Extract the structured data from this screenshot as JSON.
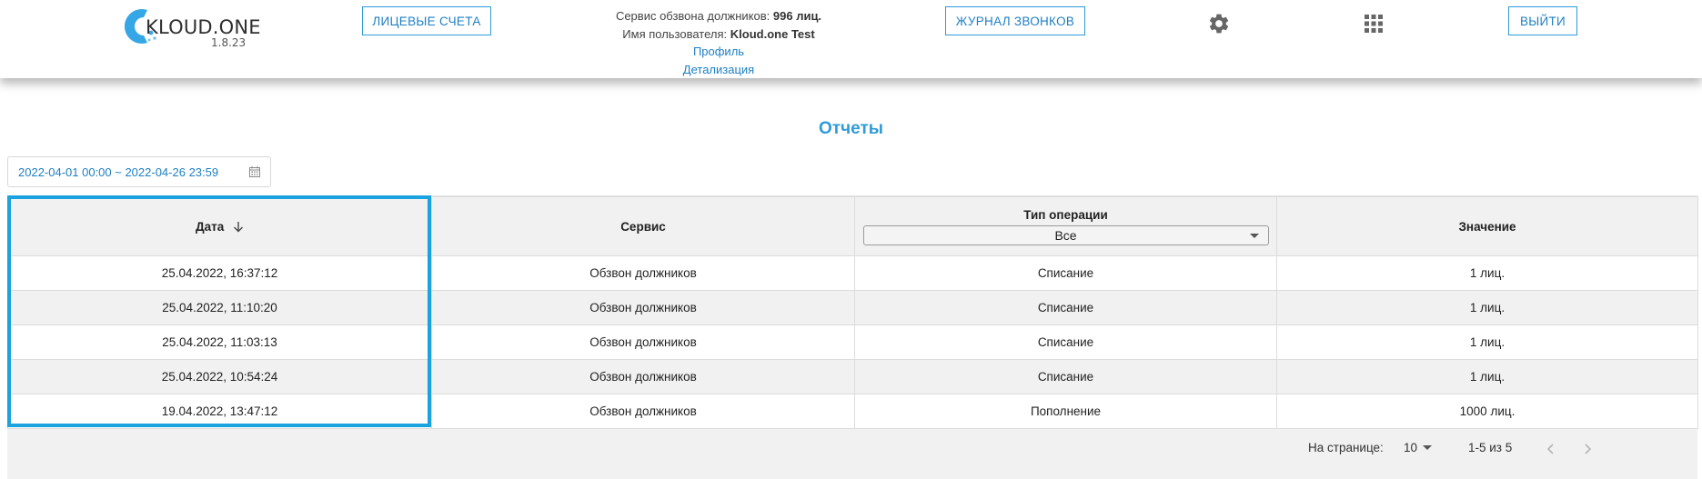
{
  "header": {
    "logo_text": "KLOUD.ONE",
    "logo_version": "1.8.23",
    "accounts_button": "ЛИЦЕВЫЕ СЧЕТА",
    "service_label": "Сервис обзвона должников:",
    "service_value": "996 лиц.",
    "user_label": "Имя пользователя:",
    "user_value": "Kloud.one Test",
    "profile_link": "Профиль",
    "details_link": "Детализация",
    "calls_button": "ЖУРНАЛ ЗВОНКОВ",
    "settings_icon": "gear-icon",
    "apps_icon": "grid-apps-icon",
    "logout_button": "ВЫЙТИ",
    "accent_color": "#2f9bd8"
  },
  "page": {
    "title": "Отчеты",
    "date_range": "2022-04-01 00:00 ~ 2022-04-26 23:59"
  },
  "table": {
    "columns": {
      "date": "Дата",
      "service": "Сервис",
      "operation": "Тип операции",
      "value": "Значение"
    },
    "operation_filter": "Все",
    "rows": [
      {
        "date": "25.04.2022, 16:37:12",
        "service": "Обзвон должников",
        "operation": "Списание",
        "value": "1 лиц."
      },
      {
        "date": "25.04.2022, 11:10:20",
        "service": "Обзвон должников",
        "operation": "Списание",
        "value": "1 лиц."
      },
      {
        "date": "25.04.2022, 11:03:13",
        "service": "Обзвон должников",
        "operation": "Списание",
        "value": "1 лиц."
      },
      {
        "date": "25.04.2022, 10:54:24",
        "service": "Обзвон должников",
        "operation": "Списание",
        "value": "1 лиц."
      },
      {
        "date": "19.04.2022, 13:47:12",
        "service": "Обзвон должников",
        "operation": "Пополнение",
        "value": "1000 лиц."
      }
    ],
    "highlight_color": "#1aa3df"
  },
  "pagination": {
    "per_page_label": "На странице:",
    "per_page_value": "10",
    "range_label": "1-5 из 5"
  }
}
